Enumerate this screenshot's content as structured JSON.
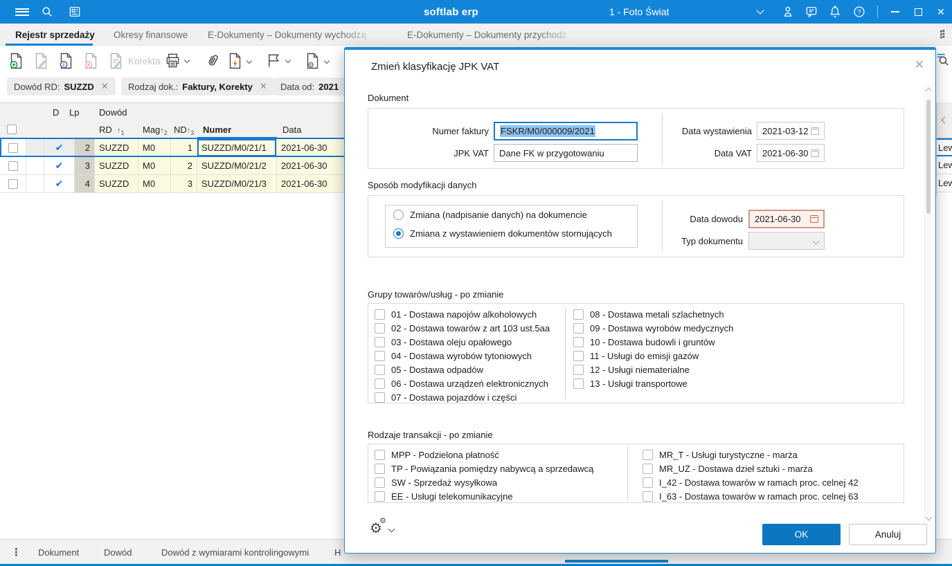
{
  "colors": {
    "topbar": "#1285d9",
    "accent": "#1080d0",
    "selection": "#8fc3ee",
    "row_yellow": "#fbfae1",
    "lp_gray": "#d7d3ca",
    "ok_button": "#0d76c0",
    "focus_border": "#1778cf",
    "warn_border": "#c99a85",
    "warn_bg": "#fdf3ec"
  },
  "topbar": {
    "title": "softlab erp",
    "company": "1 - Foto Świat"
  },
  "icons": {
    "help": "?",
    "minimize": "–",
    "close": "✕",
    "ellipsis": "⋮",
    "check": "✔",
    "collapse_left": "‹",
    "gear": "⚙"
  },
  "tabbar": {
    "tabs": [
      "Rejestr sprzedaży",
      "Okresy finansowe",
      "E-Dokumenty – Dokumenty wychodzą",
      "E-Dokumenty – Dokumenty przychodz"
    ]
  },
  "toolbar": {
    "korekta": "Korekta"
  },
  "filters": [
    {
      "label": "Dowód  RD:",
      "value": "SUZZD"
    },
    {
      "label": "Rodzaj dok.:",
      "value": "Faktury, Korekty"
    },
    {
      "label": "Data  od:",
      "value": "2021"
    }
  ],
  "grid": {
    "col_d": "D",
    "col_lp": "Lp",
    "group": "Dowód",
    "col_rd": "RD",
    "col_mag": "Mag",
    "col_nd": "ND",
    "col_numer": "Numer",
    "col_data": "Data",
    "sort_rd": "1",
    "sort_mag": "2",
    "sort_nd": "3",
    "sort_arrow": "↑",
    "rows": [
      {
        "lp": "2",
        "rd": "SUZZD",
        "mag": "M0",
        "nd": "1",
        "numer": "SUZZD/M0/21/1",
        "data": "2021-06-30",
        "side": "Lew"
      },
      {
        "lp": "3",
        "rd": "SUZZD",
        "mag": "M0",
        "nd": "2",
        "numer": "SUZZD/M0/21/2",
        "data": "2021-06-30",
        "side": "Lew"
      },
      {
        "lp": "4",
        "rd": "SUZZD",
        "mag": "M0",
        "nd": "3",
        "numer": "SUZZD/M0/21/3",
        "data": "2021-06-30",
        "side": "Lew"
      }
    ]
  },
  "modal": {
    "title": "Zmień klasyfikację JPK VAT",
    "dokument": {
      "label": "Dokument",
      "numer_faktury_label": "Numer faktury",
      "numer_faktury_value": "FSKR/M0/000009/2021",
      "jpk_vat_label": "JPK VAT",
      "jpk_vat_value": "Dane FK w przygotowaniu",
      "data_wystawienia_label": "Data wystawienia",
      "data_wystawienia_value": "2021-03-12",
      "data_vat_label": "Data VAT",
      "data_vat_value": "2021-06-30"
    },
    "sposob": {
      "label": "Sposób modyfikacji danych",
      "radio1": "Zmiana (nadpisanie danych)  na dokumencie",
      "radio2": "Zmiana z wystawieniem dokumentów stornujących",
      "data_dowodu_label": "Data dowodu",
      "data_dowodu_value": "2021-06-30",
      "typ_dokumentu_label": "Typ dokumentu",
      "typ_dokumentu_value": ""
    },
    "grupy": {
      "label": "Grupy towarów/usług - po zmianie",
      "left": [
        "01 - Dostawa napojów alkoholowych",
        "02 - Dostawa towarów z art 103 ust.5aa",
        "03 - Dostawa oleju opałowego",
        "04 - Dostawa wyrobów tytoniowych",
        "05 - Dostawa odpadów",
        "06 - Dostawa urządzeń elektronicznych",
        "07 - Dostawa pojazdów i części"
      ],
      "right": [
        "08 - Dostawa metali szlachetnych",
        "09 - Dostawa wyrobów medycznych",
        "10 - Dostawa budowli i gruntów",
        "11 - Usługi do emisji gazów",
        "12 - Usługi niematerialne",
        "13 - Usługi transportowe"
      ]
    },
    "rodzaje": {
      "label": "Rodzaje transakcji - po zmianie",
      "left": [
        "MPP - Podzielona płatność",
        "TP - Powiązania pomiędzy nabywcą a sprzedawcą",
        "SW - Sprzedaż wysyłkowa",
        "EE - Usługi telekomunikacyjne"
      ],
      "right": [
        "MR_T - Usługi turystyczne - marża",
        "MR_UZ - Dostawa dzieł sztuki - marża",
        "I_42 - Dostawa towarów w ramach proc. celnej 42",
        "I_63 - Dostawa towarów w ramach proc. celnej 63"
      ]
    },
    "ok": "OK",
    "cancel": "Anuluj"
  },
  "bottombar": {
    "tabs": [
      "Dokument",
      "Dowód",
      "Dowód z wymiarami kontrolingowymi",
      "H"
    ]
  }
}
